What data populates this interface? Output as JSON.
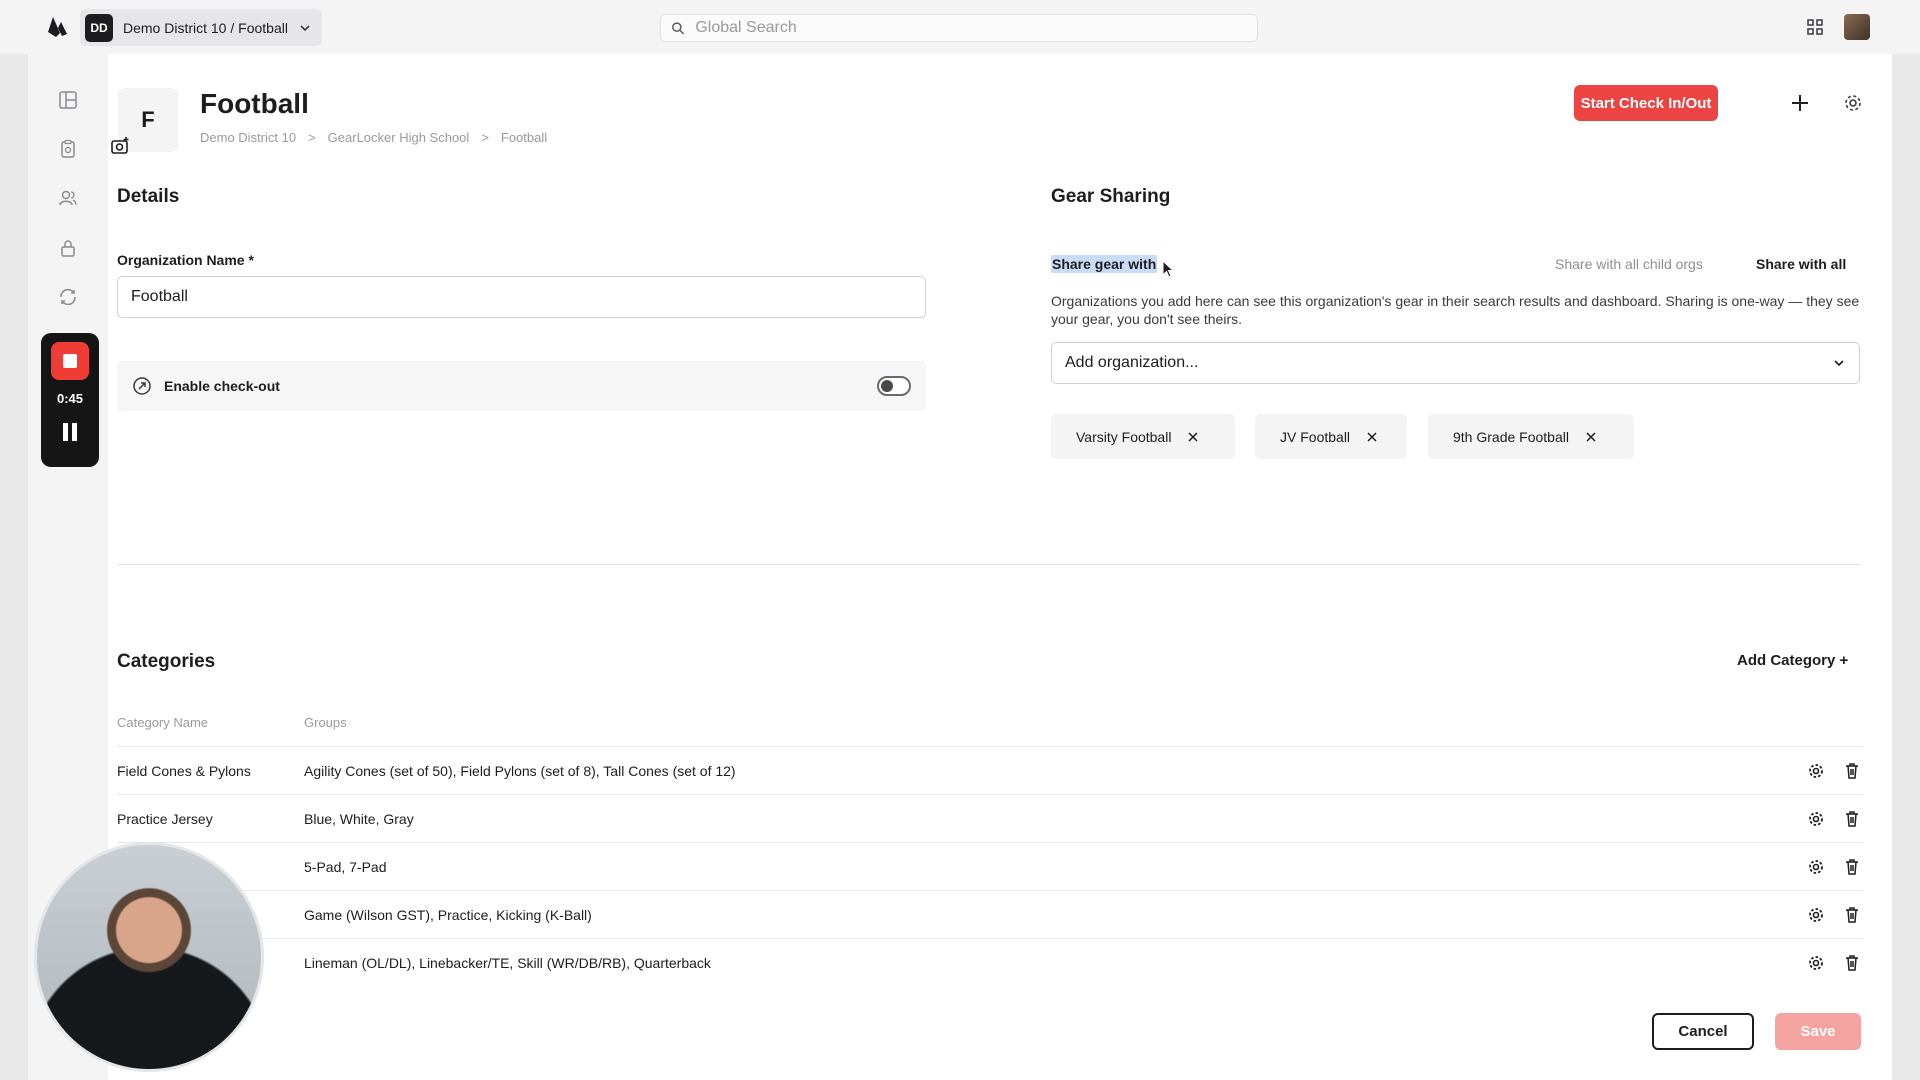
{
  "topbar": {
    "org_badge": "DD",
    "org_switch_label": "Demo District 10 / Football",
    "search_placeholder": "Global Search"
  },
  "recorder": {
    "time": "0:45"
  },
  "header": {
    "org_initial": "F",
    "title": "Football",
    "breadcrumb": [
      "Demo District 10",
      ">",
      "GearLocker High School",
      ">",
      "Football"
    ],
    "primary_button": "Start Check In/Out"
  },
  "details": {
    "heading": "Details",
    "org_name_label": "Organization Name *",
    "org_name_value": "Football",
    "checkout_label": "Enable check-out",
    "checkout_enabled": false
  },
  "gear_sharing": {
    "heading": "Gear Sharing",
    "share_label": "Share gear with",
    "share_child_orgs": "Share with all child orgs",
    "share_all": "Share with all",
    "description": "Organizations you add here can see this organization's gear in their search results and dashboard. Sharing is one-way — they see your gear, you don't see theirs.",
    "add_org_placeholder": "Add organization...",
    "shared_orgs": [
      "Varsity Football",
      "JV Football",
      "9th Grade Football"
    ]
  },
  "categories": {
    "heading": "Categories",
    "add_button": "Add Category +",
    "columns": [
      "Category Name",
      "Groups"
    ],
    "rows": [
      {
        "name": "Field Cones & Pylons",
        "groups": "Agility Cones (set of 50), Field Pylons (set of 8), Tall Cones (set of 12)"
      },
      {
        "name": "Practice Jersey",
        "groups": "Blue, White, Gray"
      },
      {
        "name": "",
        "groups": "5-Pad, 7-Pad"
      },
      {
        "name": "",
        "groups": "Game (Wilson GST), Practice, Kicking (K-Ball)"
      },
      {
        "name": "",
        "groups": "Lineman (OL/DL), Linebacker/TE, Skill (WR/DB/RB), Quarterback"
      }
    ]
  },
  "footer": {
    "cancel": "Cancel",
    "save": "Save"
  },
  "colors": {
    "accent": "#ec4442",
    "accent_disabled": "#f4a3a1",
    "highlight": "#c9dcf7"
  }
}
